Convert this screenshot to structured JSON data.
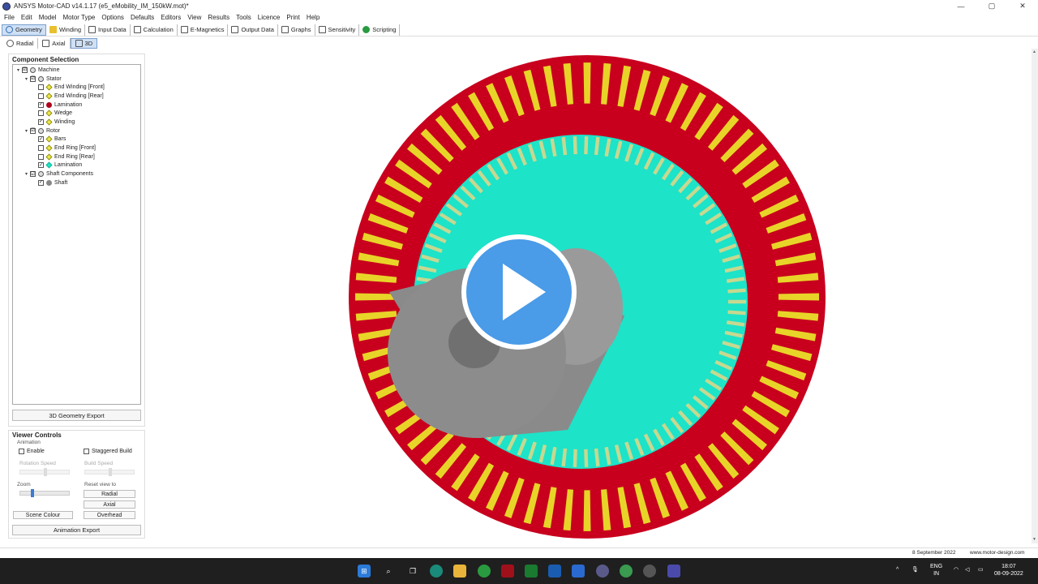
{
  "window": {
    "title": "ANSYS Motor-CAD v14.1.17 (e5_eMobility_IM_150kW.mot)*",
    "controls": [
      "—",
      "▢",
      "✕"
    ]
  },
  "menu": [
    "File",
    "Edit",
    "Model",
    "Motor Type",
    "Options",
    "Defaults",
    "Editors",
    "View",
    "Results",
    "Tools",
    "Licence",
    "Print",
    "Help"
  ],
  "toolbar": [
    {
      "label": "Geometry",
      "icon": "geometry-icon",
      "color": "#2a6ab5",
      "active": true
    },
    {
      "label": "Winding",
      "icon": "winding-icon",
      "color": "#e8c030"
    },
    {
      "label": "Input Data",
      "icon": "input-data-icon",
      "color": "#555555"
    },
    {
      "label": "Calculation",
      "icon": "calculation-icon",
      "color": "#555555"
    },
    {
      "label": "E-Magnetics",
      "icon": "e-magnetics-icon",
      "color": "#555555"
    },
    {
      "label": "Output Data",
      "icon": "output-data-icon",
      "color": "#555555"
    },
    {
      "label": "Graphs",
      "icon": "graphs-icon",
      "color": "#555555"
    },
    {
      "label": "Sensitivity",
      "icon": "sensitivity-icon",
      "color": "#555555"
    },
    {
      "label": "Scripting",
      "icon": "scripting-icon",
      "color": "#2a9a40"
    }
  ],
  "subtabs": [
    {
      "label": "Radial",
      "icon": "radial-icon",
      "active": false
    },
    {
      "label": "Axial",
      "icon": "axial-icon",
      "active": false
    },
    {
      "label": "3D",
      "icon": "3d-icon",
      "active": true
    }
  ],
  "component_selection": {
    "title": "Component Selection",
    "export_label": "3D Geometry Export",
    "tree": [
      {
        "label": "Machine",
        "level": 0,
        "expander": "▾",
        "checked": "☑",
        "icon": "machine-icon"
      },
      {
        "label": "Stator",
        "level": 1,
        "expander": "▾",
        "checked": "☑",
        "icon": "stator-icon"
      },
      {
        "label": "End Winding [Front]",
        "level": 2,
        "expander": "",
        "checked": "",
        "icon": "end-winding-front-icon"
      },
      {
        "label": "End Winding [Rear]",
        "level": 2,
        "expander": "",
        "checked": "",
        "icon": "end-winding-rear-icon"
      },
      {
        "label": "Lamination",
        "level": 2,
        "expander": "",
        "checked": "✓",
        "icon": "stator-lamination-icon"
      },
      {
        "label": "Wedge",
        "level": 2,
        "expander": "",
        "checked": "",
        "icon": "wedge-icon"
      },
      {
        "label": "Winding",
        "level": 2,
        "expander": "",
        "checked": "✓",
        "icon": "winding-node-icon"
      },
      {
        "label": "Rotor",
        "level": 1,
        "expander": "▾",
        "checked": "☑",
        "icon": "rotor-icon"
      },
      {
        "label": "Bars",
        "level": 2,
        "expander": "",
        "checked": "✓",
        "icon": "bars-icon"
      },
      {
        "label": "End Ring [Front]",
        "level": 2,
        "expander": "",
        "checked": "",
        "icon": "end-ring-front-icon"
      },
      {
        "label": "End Ring [Rear]",
        "level": 2,
        "expander": "",
        "checked": "",
        "icon": "end-ring-rear-icon"
      },
      {
        "label": "Lamination",
        "level": 2,
        "expander": "",
        "checked": "✓",
        "icon": "rotor-lamination-icon"
      },
      {
        "label": "Shaft Components",
        "level": 1,
        "expander": "▾",
        "checked": "☑",
        "icon": "shaft-components-icon"
      },
      {
        "label": "Shaft",
        "level": 2,
        "expander": "",
        "checked": "✓",
        "icon": "shaft-icon"
      }
    ]
  },
  "viewer_controls": {
    "title": "Viewer Controls",
    "animation_label": "Animation",
    "enable_label": "Enable",
    "staggered_label": "Staggered Build",
    "rotation_speed_label": "Rotation Speed",
    "build_speed_label": "Build Speed",
    "zoom_label": "Zoom",
    "reset_label": "Reset view to",
    "radial_btn": "Radial",
    "axial_btn": "Axial",
    "overhead_btn": "Overhead",
    "scene_colour_btn": "Scene Colour",
    "animation_export_btn": "Animation Export"
  },
  "status": {
    "date": "8 September 2022",
    "url": "www.motor-design.com"
  },
  "colors": {
    "stator": "#c8001e",
    "winding": "#e8d428",
    "rotor": "#1de3c8",
    "shaft": "#8c8c8c",
    "play": "#4a9be8"
  },
  "taskbar": {
    "lang_top": "ENG",
    "lang_bottom": "IN",
    "time": "18:07",
    "date": "08-09-2022"
  }
}
